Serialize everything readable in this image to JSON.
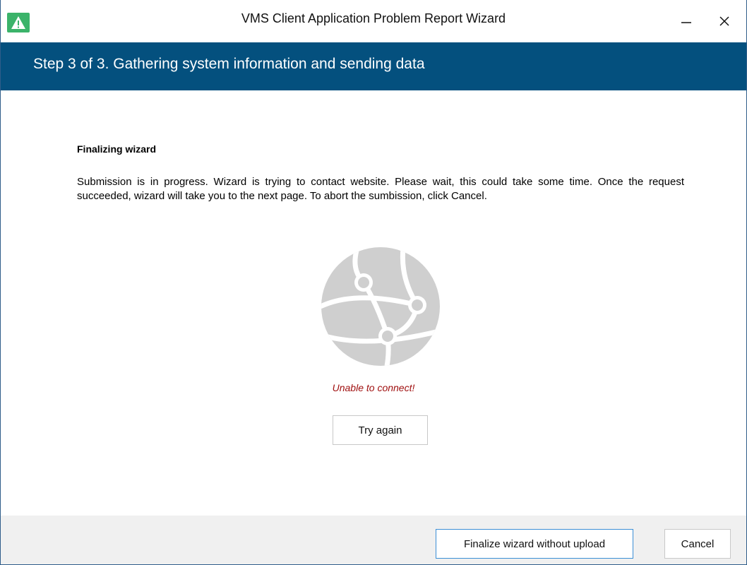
{
  "window": {
    "title": "VMS Client Application Problem Report Wizard",
    "app_icon": "warning-triangle-icon",
    "minimize_icon": "minimize-icon",
    "close_icon": "close-icon"
  },
  "banner": {
    "title": "Step 3 of 3. Gathering system information and sending data",
    "color": "#04507e"
  },
  "content": {
    "heading": "Finalizing wizard",
    "description": "Submission is in progress. Wizard is trying to contact website. Please wait, this could take some time. Once the request succeeded, wizard will take you to the next page. To abort the sumbission, click Cancel.",
    "illustration_icon": "globe-network-icon",
    "status": "Unable to connect!",
    "status_color": "#a01010",
    "retry_label": "Try again"
  },
  "footer": {
    "finalize_label": "Finalize wizard without upload",
    "cancel_label": "Cancel"
  }
}
